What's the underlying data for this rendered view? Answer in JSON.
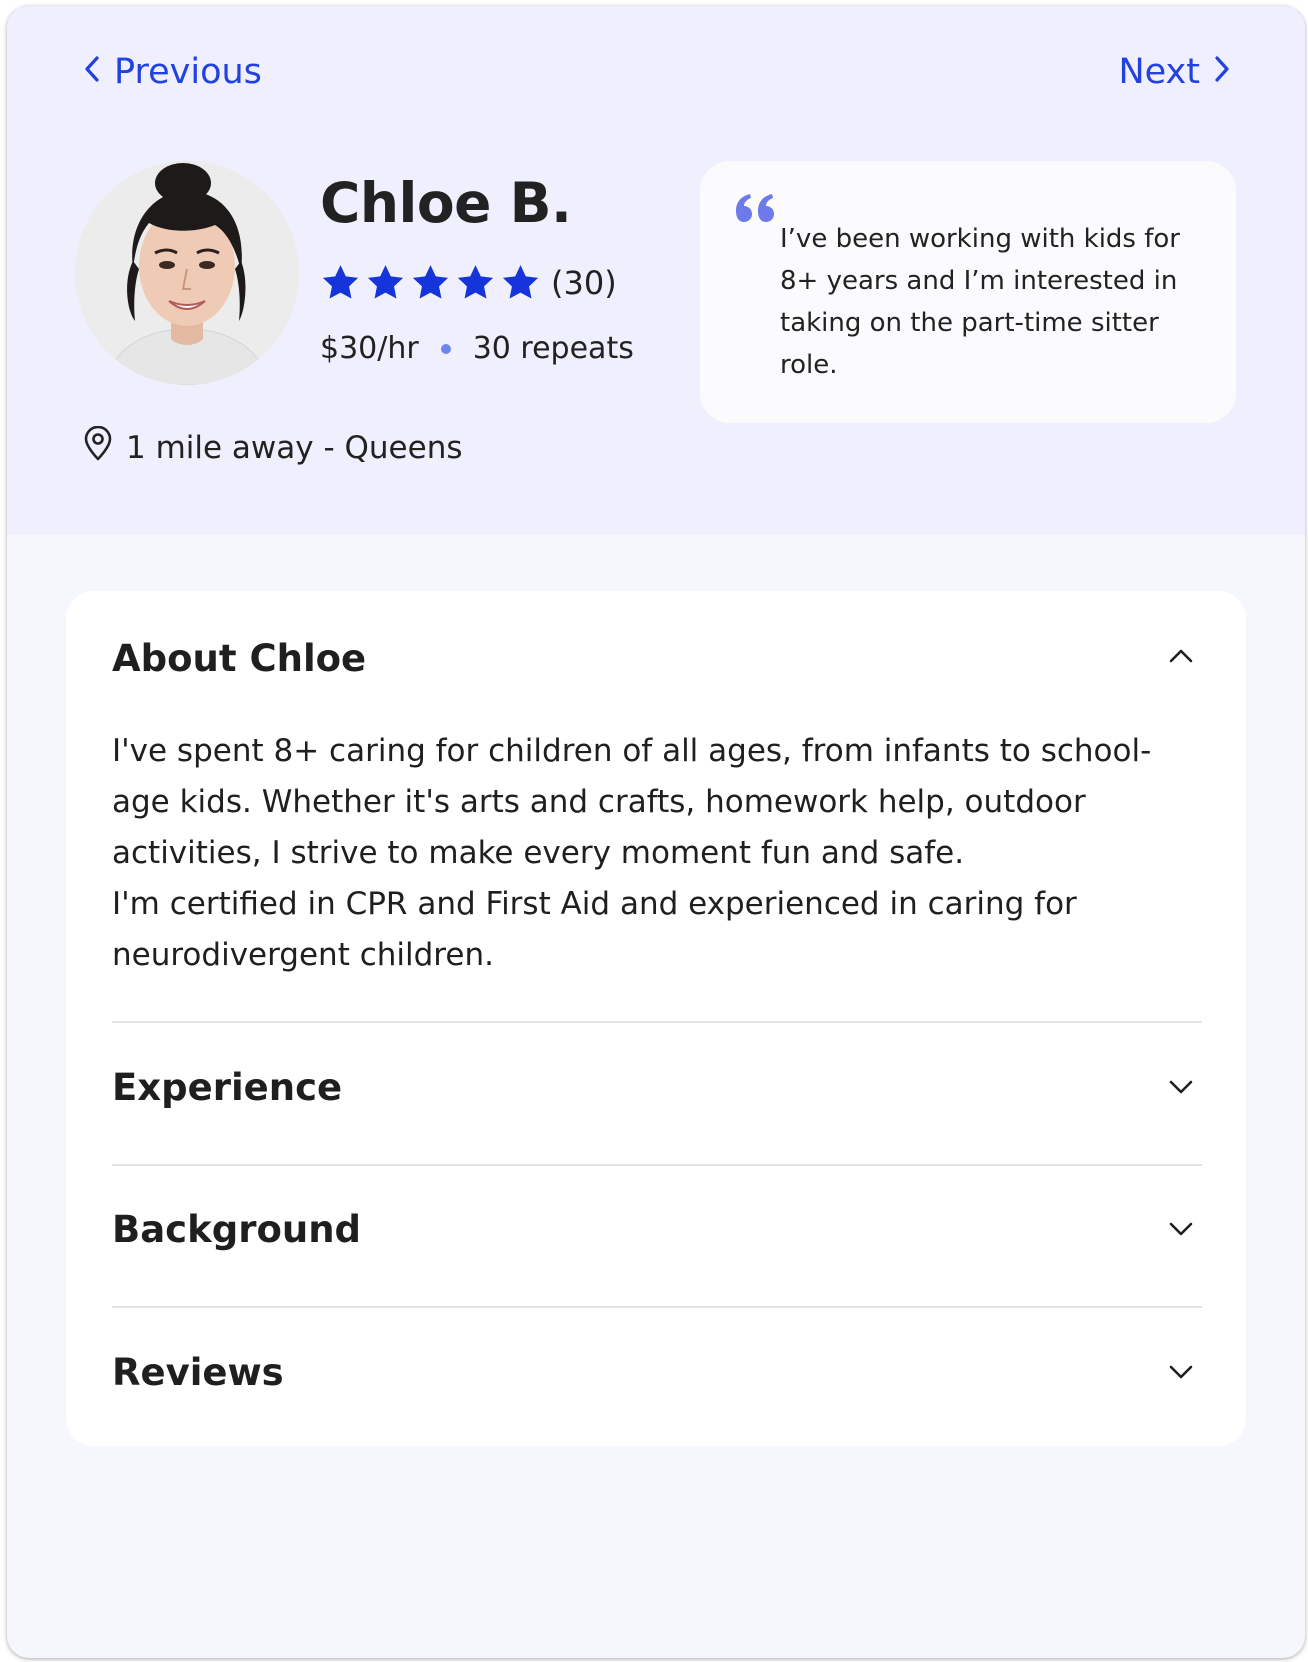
{
  "nav": {
    "previous_label": "Previous",
    "next_label": "Next"
  },
  "profile": {
    "name": "Chloe B.",
    "rating": 5,
    "rating_count": "(30)",
    "rate": "$30/hr",
    "repeats": "30 repeats",
    "location": "1 mile away - Queens"
  },
  "quote": {
    "text": "I’ve been working with kids for 8+ years and I’m interested in taking on the part-time sitter role."
  },
  "about": {
    "title": "About Chloe",
    "paragraph_1": "I've spent 8+ caring for children of all ages, from infants to school-age kids. Whether it's arts and crafts, homework help, outdoor activities, I strive to make every moment fun and safe.",
    "paragraph_2": "I'm certified in CPR and First Aid and experienced in caring for neurodivergent children."
  },
  "sections": {
    "experience_title": "Experience",
    "background_title": "Background",
    "reviews_title": "Reviews"
  },
  "colors": {
    "accent": "#2141e0",
    "star": "#1534d9",
    "header_bg": "#efeffd",
    "quote_mark": "#6d7bea"
  }
}
